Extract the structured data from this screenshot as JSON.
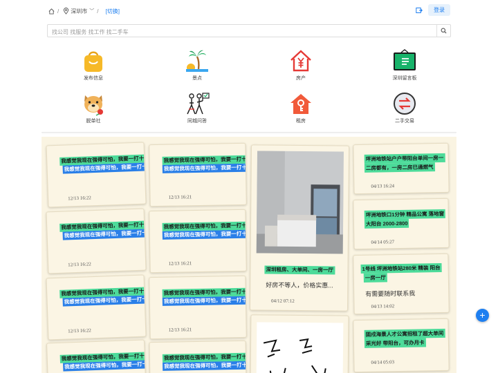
{
  "breadcrumb": {
    "city": "深圳市",
    "switch": "[切换]"
  },
  "header": {
    "login": "登录"
  },
  "search": {
    "placeholder": "找公司 找服务 找工作 找二手车"
  },
  "categories": [
    {
      "label": "发布信息",
      "icon": "shopping-bag-icon"
    },
    {
      "label": "景点",
      "icon": "palm-island-icon"
    },
    {
      "label": "房产",
      "icon": "house-yuan-icon"
    },
    {
      "label": "深圳留言板",
      "icon": "message-board-icon"
    },
    {
      "label": "脱单社",
      "icon": "dog-rose-icon"
    },
    {
      "label": "同城问答",
      "icon": "qa-people-icon"
    },
    {
      "label": "租房",
      "icon": "rent-house-icon"
    },
    {
      "label": "二手交易",
      "icon": "exchange-icon"
    }
  ],
  "notes": {
    "repeat_line1": "我感觉我现在强得可怕，我要一打十个",
    "repeat_line2": "我感觉我现在强得可怕，我要一打十个",
    "col1_times": [
      "12/13 16:22",
      "12/13 16:22",
      "12/13 16:22"
    ],
    "col2_times": [
      "12/13 16:21",
      "12/13 16:21",
      "12/13 16:21"
    ],
    "rent_title": "深圳租房、大单间、一房一厅",
    "rent_desc": "好房不等人，价格实惠...",
    "rent_time": "04/12 07:12",
    "right": [
      {
        "title": "坪洲地铁站户户带阳台单间一房一厅一房一厅二房都有，一房二房已通燃气",
        "line1": "坪洲地铁站户户带阳台单间一房一",
        "line2": "二房都有，一房二房已通燃气",
        "time": "04/13 16:24"
      },
      {
        "line1": "坪洲地铁口1分钟 精品公寓 落地窗",
        "line2": "大阳台 2000-2800",
        "time": "04/14 05:27"
      },
      {
        "line1": "1号线 坪洲地铁站280米 精装 阳台",
        "line2": "一房一厅",
        "desc": "有需要随时联系我",
        "time": "04/13 14:02"
      },
      {
        "line1": "固戍海景人才公寓招租了超大单间",
        "line2": "采光好 带阳台，可办月卡",
        "time": "04/14 05:03"
      }
    ]
  },
  "fab": {
    "label": "+"
  }
}
